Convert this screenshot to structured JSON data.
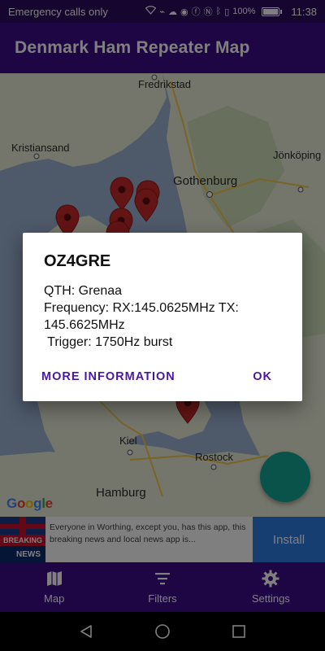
{
  "status_bar": {
    "carrier": "Emergency calls only",
    "battery": "100%",
    "time": "11:38"
  },
  "app": {
    "title": "Denmark Ham Repeater Map"
  },
  "map": {
    "labels": {
      "fredrikstad": "Fredrikstad",
      "kristiansand": "Kristiansand",
      "gothenburg": "Gothenburg",
      "jonkoping": "Jönköping",
      "kiel": "Kiel",
      "rostock": "Rostock",
      "hamburg": "Hamburg"
    },
    "attribution": "Google"
  },
  "dialog": {
    "title": "OZ4GRE",
    "qth": "QTH: Grenaa",
    "frequency": "Frequency: RX:145.0625MHz TX: 145.6625MHz",
    "trigger": " Trigger: 1750Hz burst",
    "more_info_label": "MORE INFORMATION",
    "ok_label": "OK"
  },
  "ad": {
    "logo_line1": "BREAKING",
    "logo_line2": "NEWS",
    "text": "Everyone in Worthing, except you, has this app, this breaking news and local news app is...",
    "install_label": "Install"
  },
  "bottom_nav": {
    "items": [
      {
        "label": "Map",
        "icon": "map-icon"
      },
      {
        "label": "Filters",
        "icon": "filter-icon"
      },
      {
        "label": "Settings",
        "icon": "gear-icon"
      }
    ]
  },
  "colors": {
    "primary": "#3d0d8a",
    "accent": "#14a695",
    "dialog_button": "#4a16a6",
    "marker": "#c62828"
  }
}
